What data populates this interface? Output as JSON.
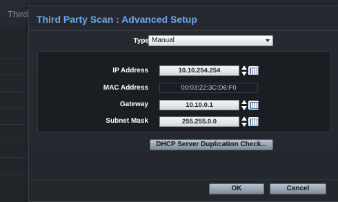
{
  "background": {
    "title": "Third"
  },
  "dialog": {
    "title": "Third Party Scan : Advanced Setup",
    "type_label": "Type",
    "type_value": "Manual",
    "fields": {
      "ip": {
        "label": "IP Address",
        "value": "10.10.254.254"
      },
      "mac": {
        "label": "MAC Address",
        "value": "00:03:22:3C:D6:F0"
      },
      "gateway": {
        "label": "Gateway",
        "value": "10.10.0.1"
      },
      "subnet": {
        "label": "Subnet Mask",
        "value": "255.255.0.0"
      }
    },
    "dhcp_button": "DHCP Server Duplication Check...",
    "ok_button": "OK",
    "cancel_button": "Cancel"
  },
  "colors": {
    "title": "#6aa8f0",
    "button": "#9aa6b3"
  }
}
